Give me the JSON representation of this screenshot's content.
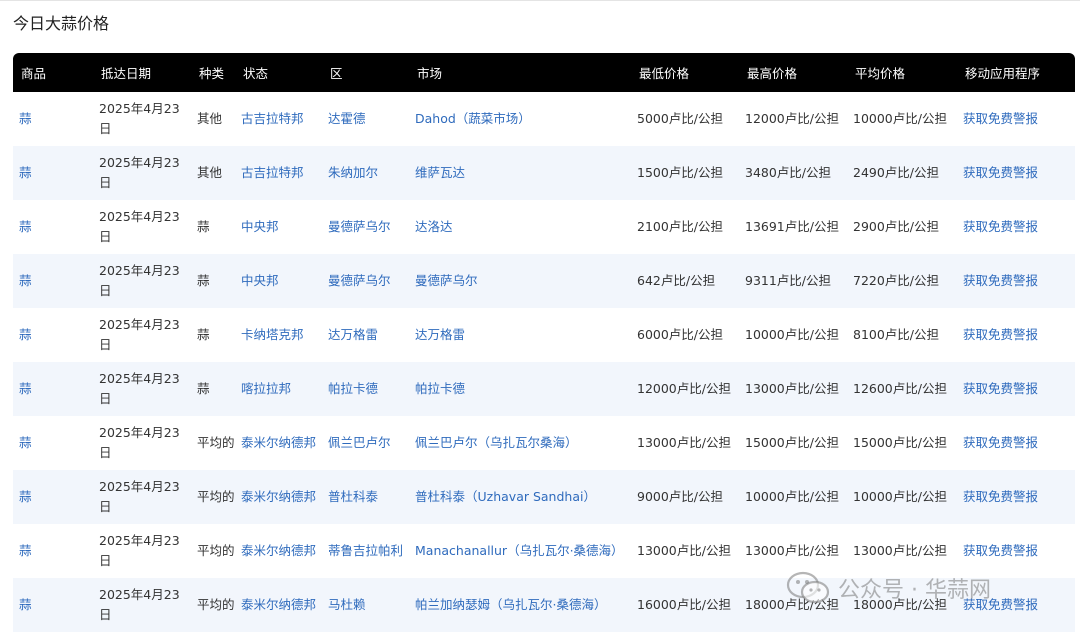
{
  "page": {
    "title": "今日大蒜价格"
  },
  "table": {
    "headers": [
      "商品",
      "抵达日期",
      "种类",
      "状态",
      "区",
      "市场",
      "最低价格",
      "最高价格",
      "平均价格",
      "移动应用程序"
    ],
    "rows": [
      {
        "commodity": "蒜",
        "date": "2025年4月23日",
        "variety": "其他",
        "state": "古吉拉特邦",
        "district": "达霍德",
        "market": "Dahod（蔬菜市场）",
        "min": "5000卢比/公担",
        "max": "12000卢比/公担",
        "avg": "10000卢比/公担",
        "app": "获取免费警报"
      },
      {
        "commodity": "蒜",
        "date": "2025年4月23日",
        "variety": "其他",
        "state": "古吉拉特邦",
        "district": "朱纳加尔",
        "market": "维萨瓦达",
        "min": "1500卢比/公担",
        "max": "3480卢比/公担",
        "avg": "2490卢比/公担",
        "app": "获取免费警报"
      },
      {
        "commodity": "蒜",
        "date": "2025年4月23日",
        "variety": "蒜",
        "state": "中央邦",
        "district": "曼德萨乌尔",
        "market": "达洛达",
        "min": "2100卢比/公担",
        "max": "13691卢比/公担",
        "avg": "2900卢比/公担",
        "app": "获取免费警报"
      },
      {
        "commodity": "蒜",
        "date": "2025年4月23日",
        "variety": "蒜",
        "state": "中央邦",
        "district": "曼德萨乌尔",
        "market": "曼德萨乌尔",
        "min": "642卢比/公担",
        "max": "9311卢比/公担",
        "avg": "7220卢比/公担",
        "app": "获取免费警报"
      },
      {
        "commodity": "蒜",
        "date": "2025年4月23日",
        "variety": "蒜",
        "state": "卡纳塔克邦",
        "district": "达万格雷",
        "market": "达万格雷",
        "min": "6000卢比/公担",
        "max": "10000卢比/公担",
        "avg": "8100卢比/公担",
        "app": "获取免费警报"
      },
      {
        "commodity": "蒜",
        "date": "2025年4月23日",
        "variety": "蒜",
        "state": "喀拉拉邦",
        "district": "帕拉卡德",
        "market": "帕拉卡德",
        "min": "12000卢比/公担",
        "max": "13000卢比/公担",
        "avg": "12600卢比/公担",
        "app": "获取免费警报"
      },
      {
        "commodity": "蒜",
        "date": "2025年4月23日",
        "variety": "平均的",
        "state": "泰米尔纳德邦",
        "district": "佩兰巴卢尔",
        "market": "佩兰巴卢尔（乌扎瓦尔桑海）",
        "min": "13000卢比/公担",
        "max": "15000卢比/公担",
        "avg": "15000卢比/公担",
        "app": "获取免费警报"
      },
      {
        "commodity": "蒜",
        "date": "2025年4月23日",
        "variety": "平均的",
        "state": "泰米尔纳德邦",
        "district": "普杜科泰",
        "market": "普杜科泰（Uzhavar Sandhai）",
        "min": "9000卢比/公担",
        "max": "10000卢比/公担",
        "avg": "10000卢比/公担",
        "app": "获取免费警报"
      },
      {
        "commodity": "蒜",
        "date": "2025年4月23日",
        "variety": "平均的",
        "state": "泰米尔纳德邦",
        "district": "蒂鲁吉拉帕利",
        "market": "Manachanallur（乌扎瓦尔·桑德海）",
        "min": "13000卢比/公担",
        "max": "13000卢比/公担",
        "avg": "13000卢比/公担",
        "app": "获取免费警报"
      },
      {
        "commodity": "蒜",
        "date": "2025年4月23日",
        "variety": "平均的",
        "state": "泰米尔纳德邦",
        "district": "马杜赖",
        "market": "帕兰加纳瑟姆（乌扎瓦尔·桑德海）",
        "min": "16000卢比/公担",
        "max": "18000卢比/公担",
        "avg": "18000卢比/公担",
        "app": "获取免费警报"
      }
    ]
  },
  "watermark": {
    "text": "公众号 · 华蒜网"
  }
}
